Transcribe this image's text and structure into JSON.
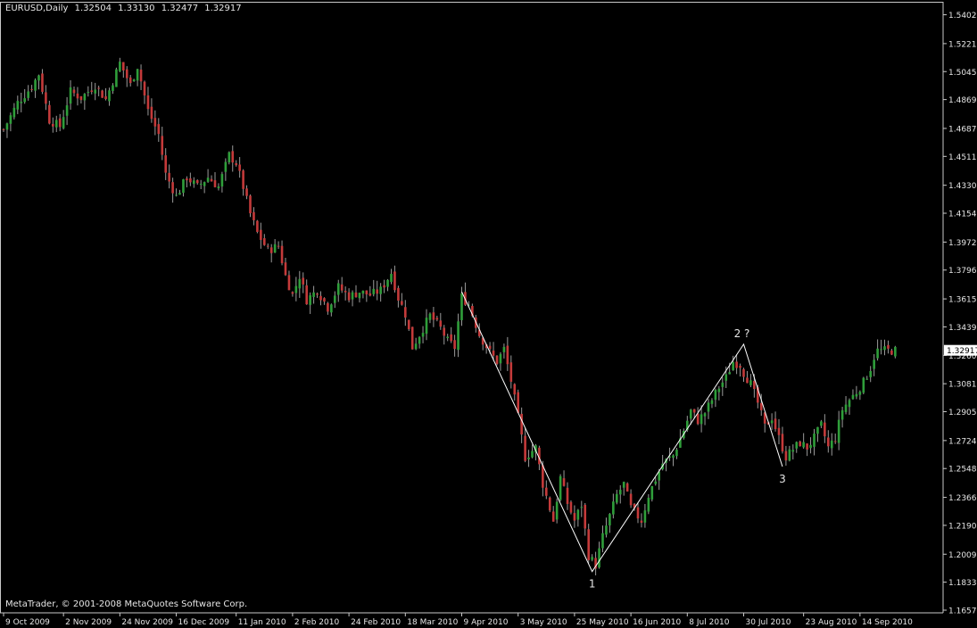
{
  "header": {
    "symbol": "EURUSD,Daily",
    "open": "1.32504",
    "high": "1.33130",
    "low": "1.32477",
    "close": "1.32917"
  },
  "copyright": "MetaTrader, © 2001-2008 MetaQuotes Software Corp.",
  "colors": {
    "background": "#000000",
    "axis": "#c8c8c8",
    "text": "#e6e6e6",
    "bull": "#2f9e3a",
    "bear": "#c43a3a",
    "wick": "#9a9a9a",
    "wave": "#ffffff",
    "price_label_bg": "#ffffff",
    "price_label_text": "#000000"
  },
  "chart_data": {
    "type": "candlestick",
    "symbol": "EURUSD",
    "timeframe": "Daily",
    "current_price": "1.32917",
    "ylim": [
      1.1657,
      1.5428
    ],
    "y_ticks": [
      "1.54025",
      "1.52210",
      "1.50450",
      "1.48690",
      "1.46875",
      "1.45115",
      "1.43300",
      "1.41540",
      "1.39725",
      "1.37965",
      "1.36150",
      "1.34390",
      "1.32600",
      "1.30815",
      "1.29055",
      "1.27240",
      "1.25480",
      "1.23665",
      "1.21905",
      "1.20090",
      "1.18330",
      "1.16570"
    ],
    "x_ticks": [
      {
        "label": "9 Oct 2009",
        "bar": 0
      },
      {
        "label": "2 Nov 2009",
        "bar": 17
      },
      {
        "label": "24 Nov 2009",
        "bar": 33
      },
      {
        "label": "16 Dec 2009",
        "bar": 49
      },
      {
        "label": "11 Jan 2010",
        "bar": 66
      },
      {
        "label": "2 Feb 2010",
        "bar": 82
      },
      {
        "label": "24 Feb 2010",
        "bar": 98
      },
      {
        "label": "18 Mar 2010",
        "bar": 114
      },
      {
        "label": "9 Apr 2010",
        "bar": 130
      },
      {
        "label": "3 May 2010",
        "bar": 146
      },
      {
        "label": "25 May 2010",
        "bar": 162
      },
      {
        "label": "16 Jun 2010",
        "bar": 178
      },
      {
        "label": "8 Jul 2010",
        "bar": 194
      },
      {
        "label": "30 Jul 2010",
        "bar": 210
      },
      {
        "label": "23 Aug 2010",
        "bar": 227
      },
      {
        "label": "14 Sep 2010",
        "bar": 243
      }
    ],
    "bar_count": 254,
    "anchors": [
      [
        0,
        1.468
      ],
      [
        4,
        1.485
      ],
      [
        8,
        1.495
      ],
      [
        10,
        1.503
      ],
      [
        13,
        1.474
      ],
      [
        16,
        1.47
      ],
      [
        19,
        1.492
      ],
      [
        22,
        1.488
      ],
      [
        26,
        1.496
      ],
      [
        29,
        1.487
      ],
      [
        33,
        1.51
      ],
      [
        36,
        1.496
      ],
      [
        38,
        1.508
      ],
      [
        41,
        1.48
      ],
      [
        44,
        1.465
      ],
      [
        46,
        1.44
      ],
      [
        49,
        1.426
      ],
      [
        52,
        1.438
      ],
      [
        55,
        1.432
      ],
      [
        58,
        1.438
      ],
      [
        61,
        1.432
      ],
      [
        64,
        1.452
      ],
      [
        66,
        1.447
      ],
      [
        68,
        1.432
      ],
      [
        70,
        1.415
      ],
      [
        72,
        1.403
      ],
      [
        75,
        1.392
      ],
      [
        78,
        1.395
      ],
      [
        80,
        1.376
      ],
      [
        82,
        1.364
      ],
      [
        84,
        1.376
      ],
      [
        86,
        1.361
      ],
      [
        89,
        1.367
      ],
      [
        92,
        1.356
      ],
      [
        95,
        1.369
      ],
      [
        98,
        1.363
      ],
      [
        101,
        1.366
      ],
      [
        104,
        1.364
      ],
      [
        107,
        1.367
      ],
      [
        110,
        1.378
      ],
      [
        112,
        1.362
      ],
      [
        114,
        1.352
      ],
      [
        116,
        1.331
      ],
      [
        118,
        1.339
      ],
      [
        121,
        1.351
      ],
      [
        124,
        1.343
      ],
      [
        126,
        1.335
      ],
      [
        128,
        1.331
      ],
      [
        130,
        1.363
      ],
      [
        132,
        1.358
      ],
      [
        135,
        1.339
      ],
      [
        138,
        1.328
      ],
      [
        140,
        1.322
      ],
      [
        142,
        1.33
      ],
      [
        144,
        1.31
      ],
      [
        146,
        1.287
      ],
      [
        148,
        1.262
      ],
      [
        151,
        1.268
      ],
      [
        153,
        1.245
      ],
      [
        156,
        1.222
      ],
      [
        158,
        1.249
      ],
      [
        160,
        1.233
      ],
      [
        162,
        1.222
      ],
      [
        164,
        1.232
      ],
      [
        166,
        1.2
      ],
      [
        168,
        1.194
      ],
      [
        170,
        1.212
      ],
      [
        172,
        1.225
      ],
      [
        174,
        1.238
      ],
      [
        176,
        1.245
      ],
      [
        178,
        1.23
      ],
      [
        181,
        1.222
      ],
      [
        183,
        1.238
      ],
      [
        185,
        1.248
      ],
      [
        187,
        1.258
      ],
      [
        190,
        1.263
      ],
      [
        193,
        1.279
      ],
      [
        195,
        1.291
      ],
      [
        197,
        1.285
      ],
      [
        199,
        1.29
      ],
      [
        201,
        1.298
      ],
      [
        203,
        1.306
      ],
      [
        205,
        1.312
      ],
      [
        207,
        1.322
      ],
      [
        209,
        1.32
      ],
      [
        210,
        1.315
      ],
      [
        212,
        1.308
      ],
      [
        214,
        1.296
      ],
      [
        216,
        1.281
      ],
      [
        218,
        1.287
      ],
      [
        220,
        1.274
      ],
      [
        222,
        1.262
      ],
      [
        224,
        1.267
      ],
      [
        226,
        1.271
      ],
      [
        228,
        1.268
      ],
      [
        230,
        1.274
      ],
      [
        232,
        1.282
      ],
      [
        234,
        1.268
      ],
      [
        236,
        1.274
      ],
      [
        238,
        1.292
      ],
      [
        240,
        1.298
      ],
      [
        242,
        1.303
      ],
      [
        244,
        1.309
      ],
      [
        246,
        1.318
      ],
      [
        247,
        1.325
      ],
      [
        248,
        1.329
      ]
    ],
    "wave": {
      "points": [
        {
          "bar": 130,
          "price": 1.366
        },
        {
          "bar": 167,
          "price": 1.19,
          "label": "1"
        },
        {
          "bar": 210,
          "price": 1.333,
          "label": "2 ?"
        },
        {
          "bar": 221,
          "price": 1.256,
          "label": "3"
        }
      ]
    },
    "legend": "none",
    "grid": false
  }
}
